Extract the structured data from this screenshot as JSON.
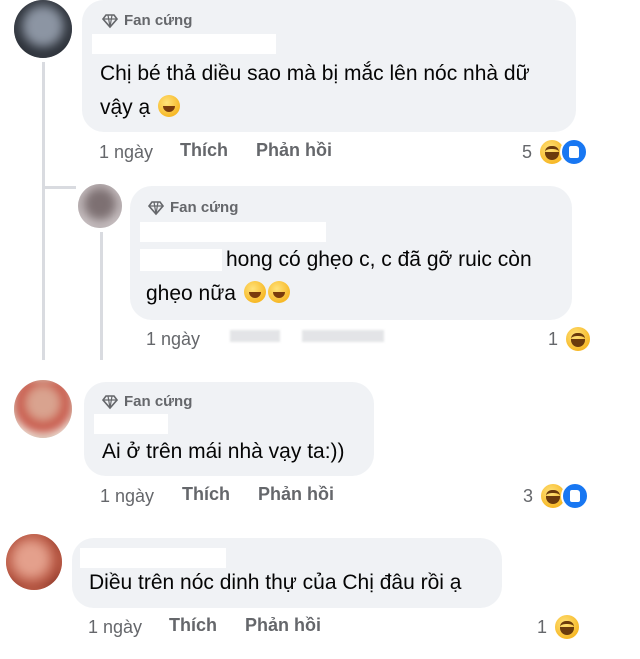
{
  "badge_label": "Fan cứng",
  "comments": [
    {
      "text_line1": "Chị bé thả diều sao mà bị mắc lên nóc nhà dữ",
      "text_line2": "vậy ạ",
      "time": "1 ngày",
      "like": "Thích",
      "reply": "Phản hồi",
      "reaction_count": "5",
      "reactions": [
        "haha-icon",
        "like-icon"
      ],
      "avatar_color": "#5a6270"
    },
    {
      "text_line1": "hong có ghẹo c, c đã gỡ ruic còn",
      "text_line2": "ghẹo nữa",
      "time": "1 ngày",
      "reaction_count": "1",
      "reactions": [
        "haha-icon"
      ],
      "avatar_color": "#9a8f90"
    },
    {
      "text_line1": "Ai ở trên mái nhà vạy ta:))",
      "time": "1 ngày",
      "like": "Thích",
      "reply": "Phản hồi",
      "reaction_count": "3",
      "reactions": [
        "haha-icon",
        "like-icon"
      ],
      "avatar_color": "#b88a7a"
    },
    {
      "text_line1": "Diều trên nóc dinh thự của Chị đâu rồi ạ",
      "time": "1 ngày",
      "like": "Thích",
      "reply": "Phản hồi",
      "reaction_count": "1",
      "reactions": [
        "haha-icon"
      ],
      "avatar_color": "#c0604a"
    }
  ]
}
